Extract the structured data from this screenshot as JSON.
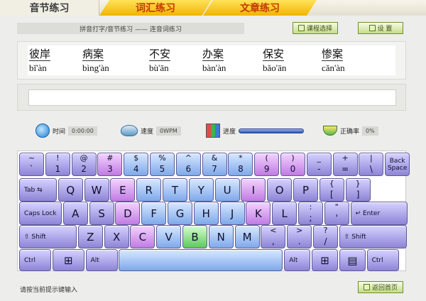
{
  "tabs": {
    "active": "音节练习",
    "vocab": "词汇练习",
    "article": "文章练习"
  },
  "crumb": "拼音打字/音节练习 —— 连音词练习",
  "buttons": {
    "course": "课程选择",
    "settings": "设 置",
    "back": "返回首页"
  },
  "words": [
    {
      "hanzi": "彼岸",
      "pinyin": "bǐ'àn"
    },
    {
      "hanzi": "病案",
      "pinyin": "bìng'àn"
    },
    {
      "hanzi": "不安",
      "pinyin": "bù'ān"
    },
    {
      "hanzi": "办案",
      "pinyin": "bàn'àn"
    },
    {
      "hanzi": "保安",
      "pinyin": "bǎo'ān"
    },
    {
      "hanzi": "惨案",
      "pinyin": "cǎn'àn"
    }
  ],
  "input": {
    "value": ""
  },
  "stats": {
    "time_label": "时间",
    "time_value": "0:00:00",
    "speed_label": "速度",
    "speed_value": "0WPM",
    "progress_label": "进度",
    "progress_fraction": 0,
    "accuracy_label": "正确率",
    "accuracy_value": "0%"
  },
  "keyboard": {
    "highlight_key": "B",
    "rows": [
      [
        {
          "top": "~",
          "bottom": "`"
        },
        {
          "top": "!",
          "bottom": "1"
        },
        {
          "top": "@",
          "bottom": "2"
        },
        {
          "top": "#",
          "bottom": "3"
        },
        {
          "top": "$",
          "bottom": "4"
        },
        {
          "top": "%",
          "bottom": "5"
        },
        {
          "top": "^",
          "bottom": "6"
        },
        {
          "top": "&",
          "bottom": "7"
        },
        {
          "top": "*",
          "bottom": "8"
        },
        {
          "top": "(",
          "bottom": "9"
        },
        {
          "top": ")",
          "bottom": "0"
        },
        {
          "top": "_",
          "bottom": "-"
        },
        {
          "top": "+",
          "bottom": "="
        },
        {
          "top": "|",
          "bottom": "\\"
        },
        {
          "label": "Back\nSpace"
        }
      ],
      [
        {
          "label": "Tab ⇆"
        },
        {
          "label": "Q"
        },
        {
          "label": "W"
        },
        {
          "label": "E"
        },
        {
          "label": "R"
        },
        {
          "label": "T"
        },
        {
          "label": "Y"
        },
        {
          "label": "U"
        },
        {
          "label": "I"
        },
        {
          "label": "O"
        },
        {
          "label": "P"
        },
        {
          "top": "{",
          "bottom": "["
        },
        {
          "top": "}",
          "bottom": "]"
        }
      ],
      [
        {
          "label": "Caps Lock"
        },
        {
          "label": "A"
        },
        {
          "label": "S"
        },
        {
          "label": "D"
        },
        {
          "label": "F"
        },
        {
          "label": "G"
        },
        {
          "label": "H"
        },
        {
          "label": "J"
        },
        {
          "label": "K"
        },
        {
          "label": "L"
        },
        {
          "top": ":",
          "bottom": ";"
        },
        {
          "top": "\"",
          "bottom": "'"
        },
        {
          "label": "↵ Enter"
        }
      ],
      [
        {
          "label": "⇧ Shift"
        },
        {
          "label": "Z"
        },
        {
          "label": "X"
        },
        {
          "label": "C"
        },
        {
          "label": "V"
        },
        {
          "label": "B"
        },
        {
          "label": "N"
        },
        {
          "label": "M"
        },
        {
          "top": "<",
          "bottom": ","
        },
        {
          "top": ">",
          "bottom": "."
        },
        {
          "top": "?",
          "bottom": "/"
        },
        {
          "label": "⇧ Shift"
        }
      ],
      [
        {
          "label": "Ctrl"
        },
        {
          "label": "⊞"
        },
        {
          "label": "Alt"
        },
        {
          "label": ""
        },
        {
          "label": "Alt"
        },
        {
          "label": "⊞"
        },
        {
          "label": "▤"
        },
        {
          "label": "Ctrl"
        }
      ]
    ]
  },
  "hint": "请按当前提示键输入",
  "colors": {
    "tab_active_text": "#3c3c3c",
    "tab_text": "#c33a00",
    "key_default": "#8d84d6",
    "key_pink": "#c07be3",
    "key_blue": "#7ea9ea",
    "key_green": "#5cc95a"
  }
}
